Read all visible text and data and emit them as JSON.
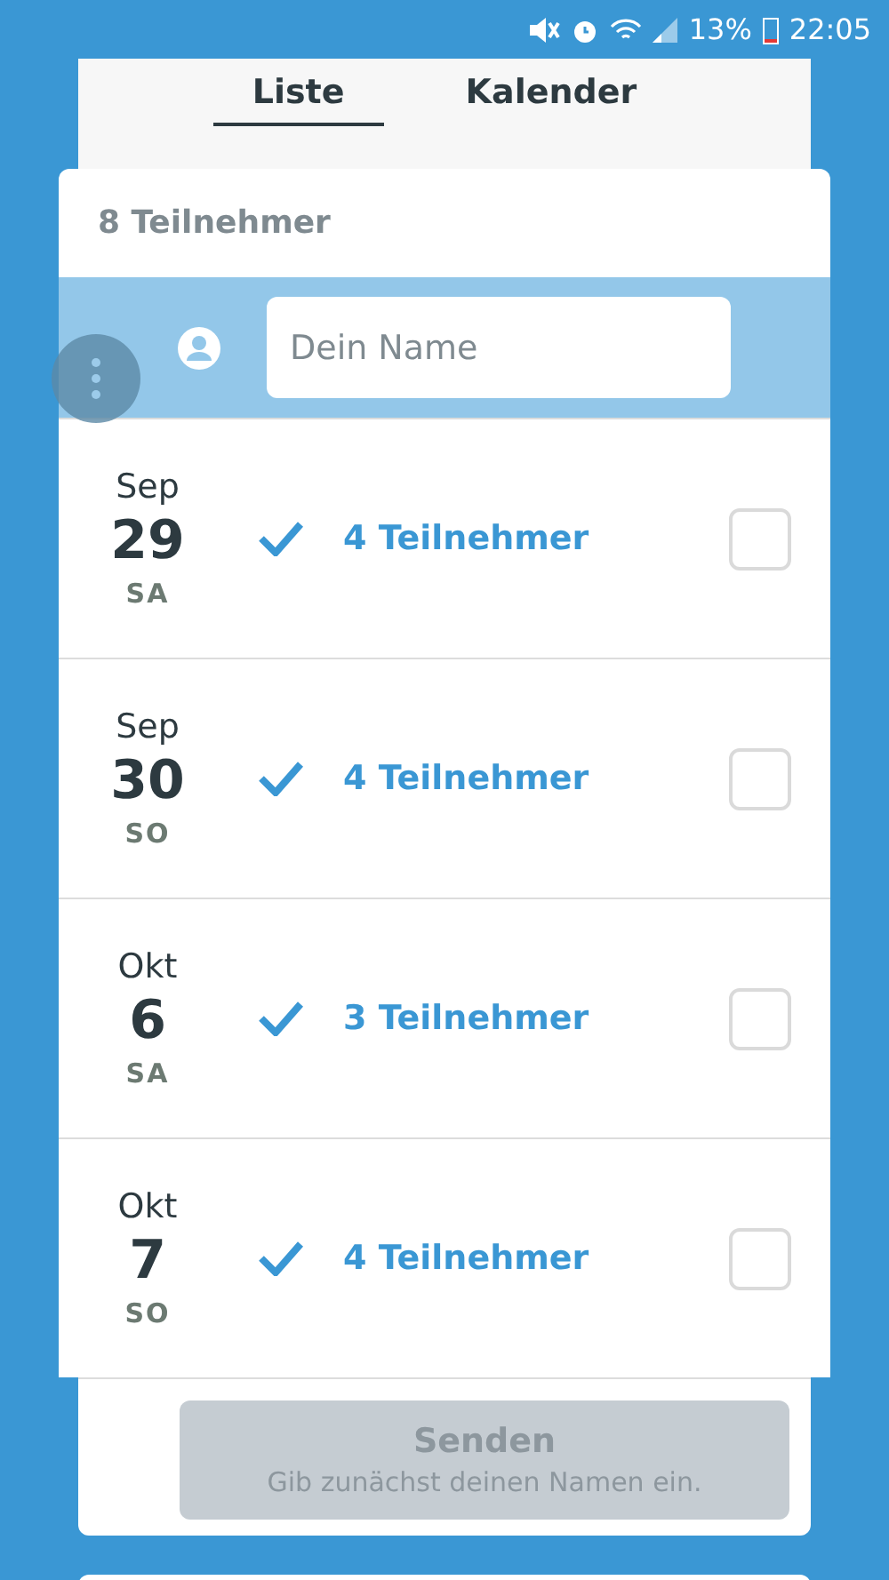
{
  "status_bar": {
    "battery": "13%",
    "time": "22:05"
  },
  "tabs": [
    {
      "label": "Liste",
      "selected": true
    },
    {
      "label": "Kalender",
      "selected": false
    }
  ],
  "participants_count": "8 Teilnehmer",
  "name_field": {
    "placeholder": "Dein Name"
  },
  "dates": [
    {
      "month": "Sep",
      "day": "29",
      "weekday": "SA",
      "participants": "4 Teilnehmer",
      "checked": false
    },
    {
      "month": "Sep",
      "day": "30",
      "weekday": "SO",
      "participants": "4 Teilnehmer",
      "checked": false
    },
    {
      "month": "Okt",
      "day": "6",
      "weekday": "SA",
      "participants": "3 Teilnehmer",
      "checked": false
    },
    {
      "month": "Okt",
      "day": "7",
      "weekday": "SO",
      "participants": "4 Teilnehmer",
      "checked": false
    }
  ],
  "send_button": {
    "label": "Senden",
    "hint": "Gib zunächst deinen Namen ein.",
    "disabled": true
  }
}
